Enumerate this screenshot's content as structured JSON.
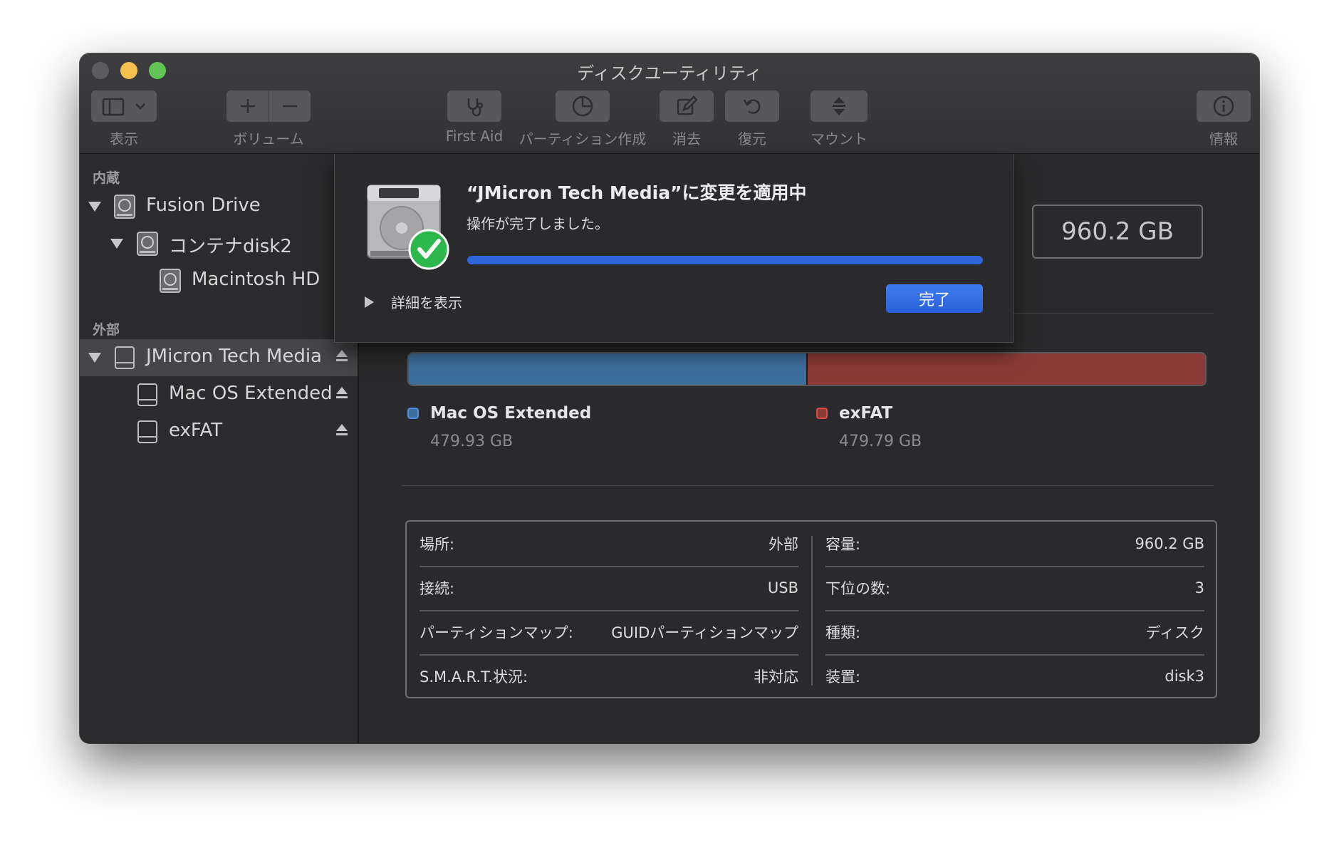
{
  "window": {
    "title": "ディスクユーティリティ"
  },
  "toolbar": {
    "view_label": "表示",
    "volume_label": "ボリューム",
    "first_aid_label": "First Aid",
    "partition_label": "パーティション作成",
    "erase_label": "消去",
    "restore_label": "復元",
    "mount_label": "マウント",
    "info_label": "情報"
  },
  "sidebar": {
    "internal_header": "内蔵",
    "external_header": "外部",
    "internal_items": [
      {
        "label": "Fusion Drive",
        "icon": "internal-disk-icon"
      },
      {
        "label": "コンテナdisk2",
        "icon": "container-icon"
      },
      {
        "label": "Macintosh HD",
        "icon": "volume-icon"
      }
    ],
    "external_items": [
      {
        "label": "JMicron Tech Media",
        "icon": "external-disk-icon"
      },
      {
        "label": "Mac OS Extended",
        "icon": "volume-icon"
      },
      {
        "label": "exFAT",
        "icon": "volume-icon"
      }
    ]
  },
  "main": {
    "capacity": "960.2 GB",
    "partitions": [
      {
        "name": "Mac OS Extended",
        "size": "479.93 GB",
        "fraction": 0.5,
        "color": "#3d6f9d",
        "swatch": "#4a90d9"
      },
      {
        "name": "exFAT",
        "size": "479.79 GB",
        "fraction": 0.5,
        "color": "#8c3a38",
        "swatch": "#e04a45"
      }
    ],
    "info_left": [
      {
        "key": "場所:",
        "value": "外部"
      },
      {
        "key": "接続:",
        "value": "USB"
      },
      {
        "key": "パーティションマップ:",
        "value": "GUIDパーティションマップ"
      },
      {
        "key": "S.M.A.R.T.状況:",
        "value": "非対応"
      }
    ],
    "info_right": [
      {
        "key": "容量:",
        "value": "960.2 GB"
      },
      {
        "key": "下位の数:",
        "value": "3"
      },
      {
        "key": "種類:",
        "value": "ディスク"
      },
      {
        "key": "装置:",
        "value": "disk3"
      }
    ]
  },
  "sheet": {
    "title": "“JMicron Tech Media”に変更を適用中",
    "status": "操作が完了しました。",
    "progress": 1.0,
    "details_label": "詳細を表示",
    "done_label": "完了"
  }
}
